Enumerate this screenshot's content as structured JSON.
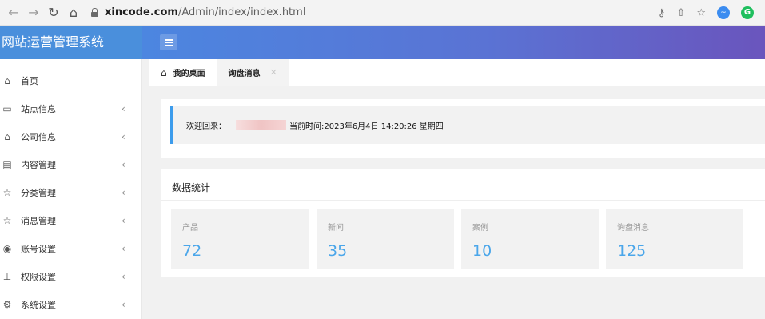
{
  "browser": {
    "url_host": "xincode.com",
    "url_path": "/Admin/index/index.html"
  },
  "app": {
    "title": "网站运营管理系统"
  },
  "sidebar": {
    "items": [
      {
        "label": "首页",
        "icon": "home-icon",
        "glyph": "⌂",
        "has_chevron": false
      },
      {
        "label": "站点信息",
        "icon": "monitor-icon",
        "glyph": "🖵",
        "has_chevron": true
      },
      {
        "label": "公司信息",
        "icon": "bank-icon",
        "glyph": "🏛",
        "has_chevron": true
      },
      {
        "label": "内容管理",
        "icon": "file-icon",
        "glyph": "▤",
        "has_chevron": true
      },
      {
        "label": "分类管理",
        "icon": "star-icon",
        "glyph": "☆",
        "has_chevron": true
      },
      {
        "label": "消息管理",
        "icon": "star-icon",
        "glyph": "☆",
        "has_chevron": true
      },
      {
        "label": "账号设置",
        "icon": "user-circle-icon",
        "glyph": "◉",
        "has_chevron": true
      },
      {
        "label": "权限设置",
        "icon": "sitemap-icon",
        "glyph": "⊥",
        "has_chevron": true
      },
      {
        "label": "系统设置",
        "icon": "gear-icon",
        "glyph": "⚙",
        "has_chevron": true
      }
    ]
  },
  "tabs": [
    {
      "label": "我的桌面"
    },
    {
      "label": "询盘消息"
    }
  ],
  "welcome": {
    "greeting": "欢迎回来：",
    "time_text": "当前时间:2023年6月4日 14:20:26 星期四"
  },
  "stats": {
    "title": "数据统计",
    "cards": [
      {
        "label": "产品",
        "value": "72"
      },
      {
        "label": "新闻",
        "value": "35"
      },
      {
        "label": "案例",
        "value": "10"
      },
      {
        "label": "询盘消息",
        "value": "125"
      }
    ]
  },
  "colors": {
    "accent": "#4aa6ea",
    "logo_bg": "#4a8fdc",
    "topbar_start": "#4c86e0",
    "topbar_end": "#6a55bd"
  }
}
